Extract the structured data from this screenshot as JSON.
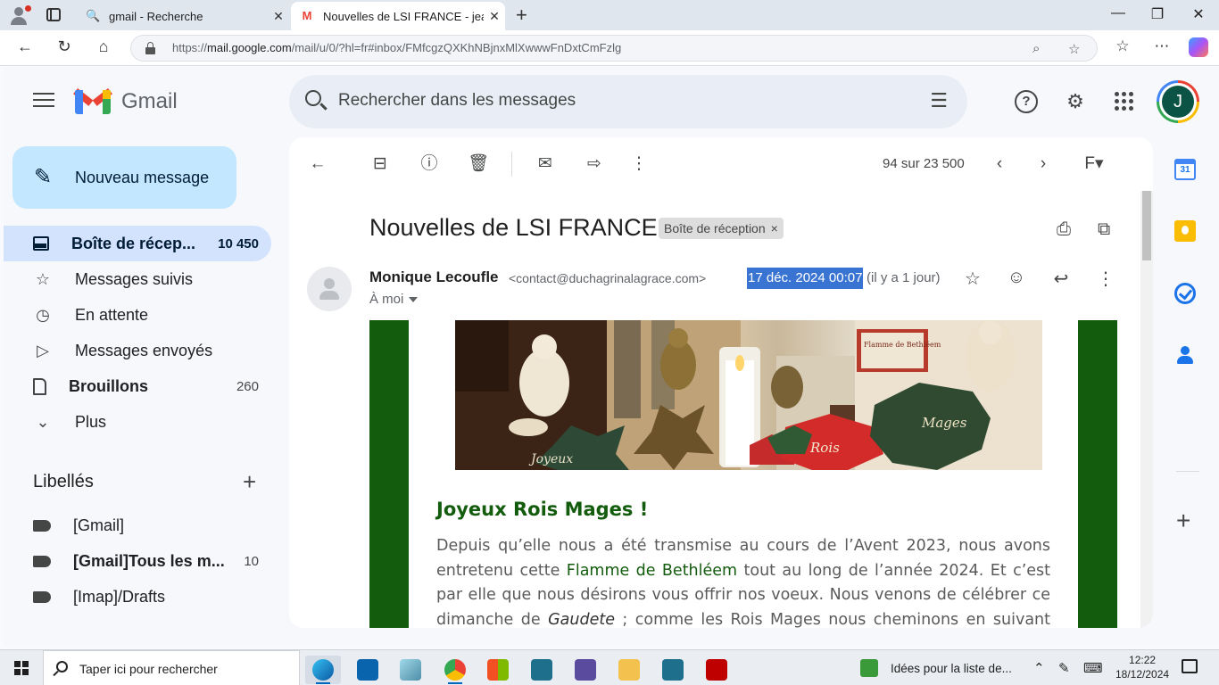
{
  "browser": {
    "tabs": [
      {
        "title": "gmail - Recherche",
        "icon": "search-icon",
        "active": false
      },
      {
        "title": "Nouvelles de LSI FRANCE - jeanyv",
        "icon": "gmail-icon",
        "active": true
      }
    ],
    "url_prefix": "https://",
    "url_domain": "mail.google.com",
    "url_path": "/mail/u/0/?hl=fr#inbox/FMfcgzQXKhNBjnxMlXwwwFnDxtCmFzlg"
  },
  "gmail": {
    "logo_text": "Gmail",
    "search_placeholder": "Rechercher dans les messages",
    "avatar_letter": "J",
    "compose_label": "Nouveau message",
    "nav": [
      {
        "label": "Boîte de récep...",
        "count": "10 450",
        "icon": "inbox-icon",
        "active": true
      },
      {
        "label": "Messages suivis",
        "count": "",
        "icon": "star-icon"
      },
      {
        "label": "En attente",
        "count": "",
        "icon": "clock-icon"
      },
      {
        "label": "Messages envoyés",
        "count": "",
        "icon": "send-icon"
      },
      {
        "label": "Brouillons",
        "count": "260",
        "icon": "draft-icon",
        "bold": true
      },
      {
        "label": "Plus",
        "count": "",
        "icon": "chevron-down-icon"
      }
    ],
    "labels_heading": "Libellés",
    "labels": [
      {
        "label": "[Gmail]",
        "count": ""
      },
      {
        "label": "[Gmail]Tous les m...",
        "count": "10",
        "bold": true
      },
      {
        "label": "[Imap]/Drafts",
        "count": ""
      }
    ]
  },
  "message": {
    "counter": "94 sur 23 500",
    "subject": "Nouvelles de LSI FRANCE",
    "chip": "Boîte de réception",
    "sender_name": "Monique Lecoufle",
    "sender_email": "<contact@duchagrinalagrace.com>",
    "date": "17 déc. 2024 00:07",
    "ago": "(il y a 1 jour)",
    "to": "À moi",
    "body_heading": "Joyeux Rois Mages !",
    "body_p1": "Depuis qu’elle nous a été transmise au cours de l’Avent 2023, nous avons entretenu cette ",
    "body_link": "Flamme de Bethléem",
    "body_p2": " tout  au long de l’année 2024. Et c’est par elle que nous désirons vous offrir nos voeux. Nous venons de célébrer ce dimanche de ",
    "body_em": "Gaudete",
    "body_p3": " ; comme les Rois Mages nous cheminons en suivant l’Etoile,",
    "photo_texts": [
      "Joyeux",
      "Rois",
      "Mages",
      "Flamme de Bethléem"
    ]
  },
  "side_panel": {
    "calendar_day": "31"
  },
  "taskbar": {
    "search_placeholder": "Taper ici pour rechercher",
    "news": "Idées pour la liste de...",
    "time": "12:22",
    "date": "18/12/2024"
  },
  "colors": {
    "accent": "#0b57d0",
    "compose_bg": "#c2e7ff",
    "active_nav_bg": "#d3e3fd",
    "email_green": "#135c0e",
    "date_highlight": "#3a74d2"
  }
}
